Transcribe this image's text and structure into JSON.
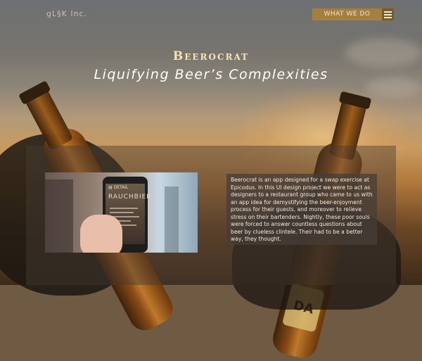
{
  "header": {
    "brand": "gL§K Inc.",
    "nav_label": "WHAT WE DO",
    "menu_icon": "hamburger-menu-icon"
  },
  "hero": {
    "title": "Beerocrat",
    "subtitle": "Liquifying Beer’s Complexities"
  },
  "project": {
    "description": "Beerocrat is an app designed for a swap exercise at Epicodus. In this UI design project we were to act as designers to a restaurant group who came to us with an app idea for demystifying the beer-enjoyment process for their guests, and moreover to relieve stress on their bartenders. Nightly, these poor souls were forced to answer countless questions about beer by clueless clintele. Their had to be a better way, they thought.",
    "image": {
      "screen_header": "▤ DETAIL",
      "screen_title": "RAUCHBIER"
    }
  },
  "colors": {
    "nav_bg": "#a8803c",
    "title": "#f5e5b5",
    "panel_bg": "rgba(70,60,50,0.45)"
  }
}
